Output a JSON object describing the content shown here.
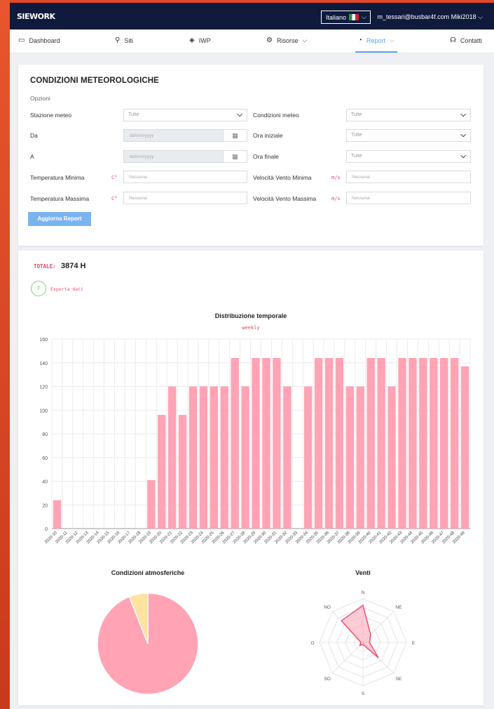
{
  "header": {
    "logo": "SIEWORK",
    "language": "Italiano",
    "user": "m_tessari@busbar4f.com Miki2018"
  },
  "nav": [
    {
      "label": "Dashboard",
      "icon": "monitor-icon"
    },
    {
      "label": "Siti",
      "icon": "location-pin-icon"
    },
    {
      "label": "IWP",
      "icon": "layers-icon"
    },
    {
      "label": "Risorse",
      "icon": "gear-icon"
    },
    {
      "label": "Report",
      "icon": "chart-icon"
    },
    {
      "label": "Contatti",
      "icon": "headset-icon"
    }
  ],
  "form": {
    "title": "CONDIZIONI METEOROLOGICHE",
    "options_label": "Opzioni",
    "stazione_meteo": {
      "label": "Stazione meteo",
      "value": "Tutte"
    },
    "condizioni_meteo": {
      "label": "Condizioni meteo",
      "value": "Tutte"
    },
    "da": {
      "label": "Da",
      "placeholder": "dd/mm/yyyy"
    },
    "ora_iniziale": {
      "label": "Ora iniziale",
      "value": "Tutte"
    },
    "a": {
      "label": "A",
      "placeholder": "dd/mm/yyyy"
    },
    "ora_finale": {
      "label": "Ora finale",
      "value": "Tutte"
    },
    "temp_min": {
      "label": "Temperatura Minima",
      "unit": "C°",
      "placeholder": "Nessuna"
    },
    "vento_min": {
      "label": "Velocità Vento Minima",
      "unit": "m/s",
      "placeholder": "Nessuna"
    },
    "temp_max": {
      "label": "Temperatura Massima",
      "unit": "C°",
      "placeholder": "Nessuna"
    },
    "vento_max": {
      "label": "Velocità Vento Massima",
      "unit": "m/s",
      "placeholder": "Nessuna"
    },
    "button": "Aggiorna Report"
  },
  "report": {
    "total_label": "TOTALE:",
    "total_value": "3874 H",
    "export_label": "Esporta dati"
  },
  "chart_data": [
    {
      "type": "bar",
      "title": "Distribuzione temporale",
      "subtitle": "weekly",
      "color": "#ffa3b5",
      "ylim": [
        0,
        160
      ],
      "yticks": [
        0,
        20,
        40,
        60,
        80,
        100,
        120,
        140,
        160
      ],
      "grid": true,
      "categories": [
        "2020-10",
        "2020-11",
        "2020-12",
        "2020-13",
        "2020-14",
        "2020-15",
        "2020-16",
        "2020-17",
        "2020-18",
        "2020-19",
        "2020-20",
        "2020-21",
        "2020-22",
        "2020-23",
        "2020-24",
        "2020-25",
        "2020-26",
        "2020-27",
        "2020-28",
        "2020-29",
        "2020-30",
        "2020-31",
        "2020-32",
        "2020-33",
        "2020-34",
        "2020-35",
        "2020-36",
        "2020-37",
        "2020-38",
        "2020-39",
        "2020-40",
        "2020-41",
        "2020-42",
        "2020-43",
        "2020-44",
        "2020-45",
        "2020-46",
        "2020-47",
        "2020-48",
        "2020-49"
      ],
      "values": [
        24,
        0,
        0,
        0,
        0,
        0,
        0,
        0,
        0,
        41,
        96,
        120,
        96,
        120,
        120,
        120,
        120,
        144,
        120,
        144,
        144,
        144,
        120,
        0,
        120,
        144,
        144,
        144,
        120,
        120,
        144,
        144,
        120,
        144,
        144,
        144,
        144,
        144,
        144,
        137
      ]
    },
    {
      "type": "pie",
      "title": "Condizioni atmosferiche",
      "slices": [
        {
          "value": 94,
          "color": "#ffa3b5"
        },
        {
          "value": 6,
          "color": "#ffe1a0"
        }
      ]
    },
    {
      "type": "radar",
      "title": "Venti",
      "axes": [
        "N",
        "NE",
        "E",
        "SE",
        "S",
        "SO",
        "O",
        "NO"
      ],
      "values": [
        0.85,
        0.25,
        0.15,
        0.5,
        0.05,
        0.1,
        0.05,
        0.7
      ],
      "color": "#ffa3b5",
      "stroke": "#e8527a"
    }
  ]
}
